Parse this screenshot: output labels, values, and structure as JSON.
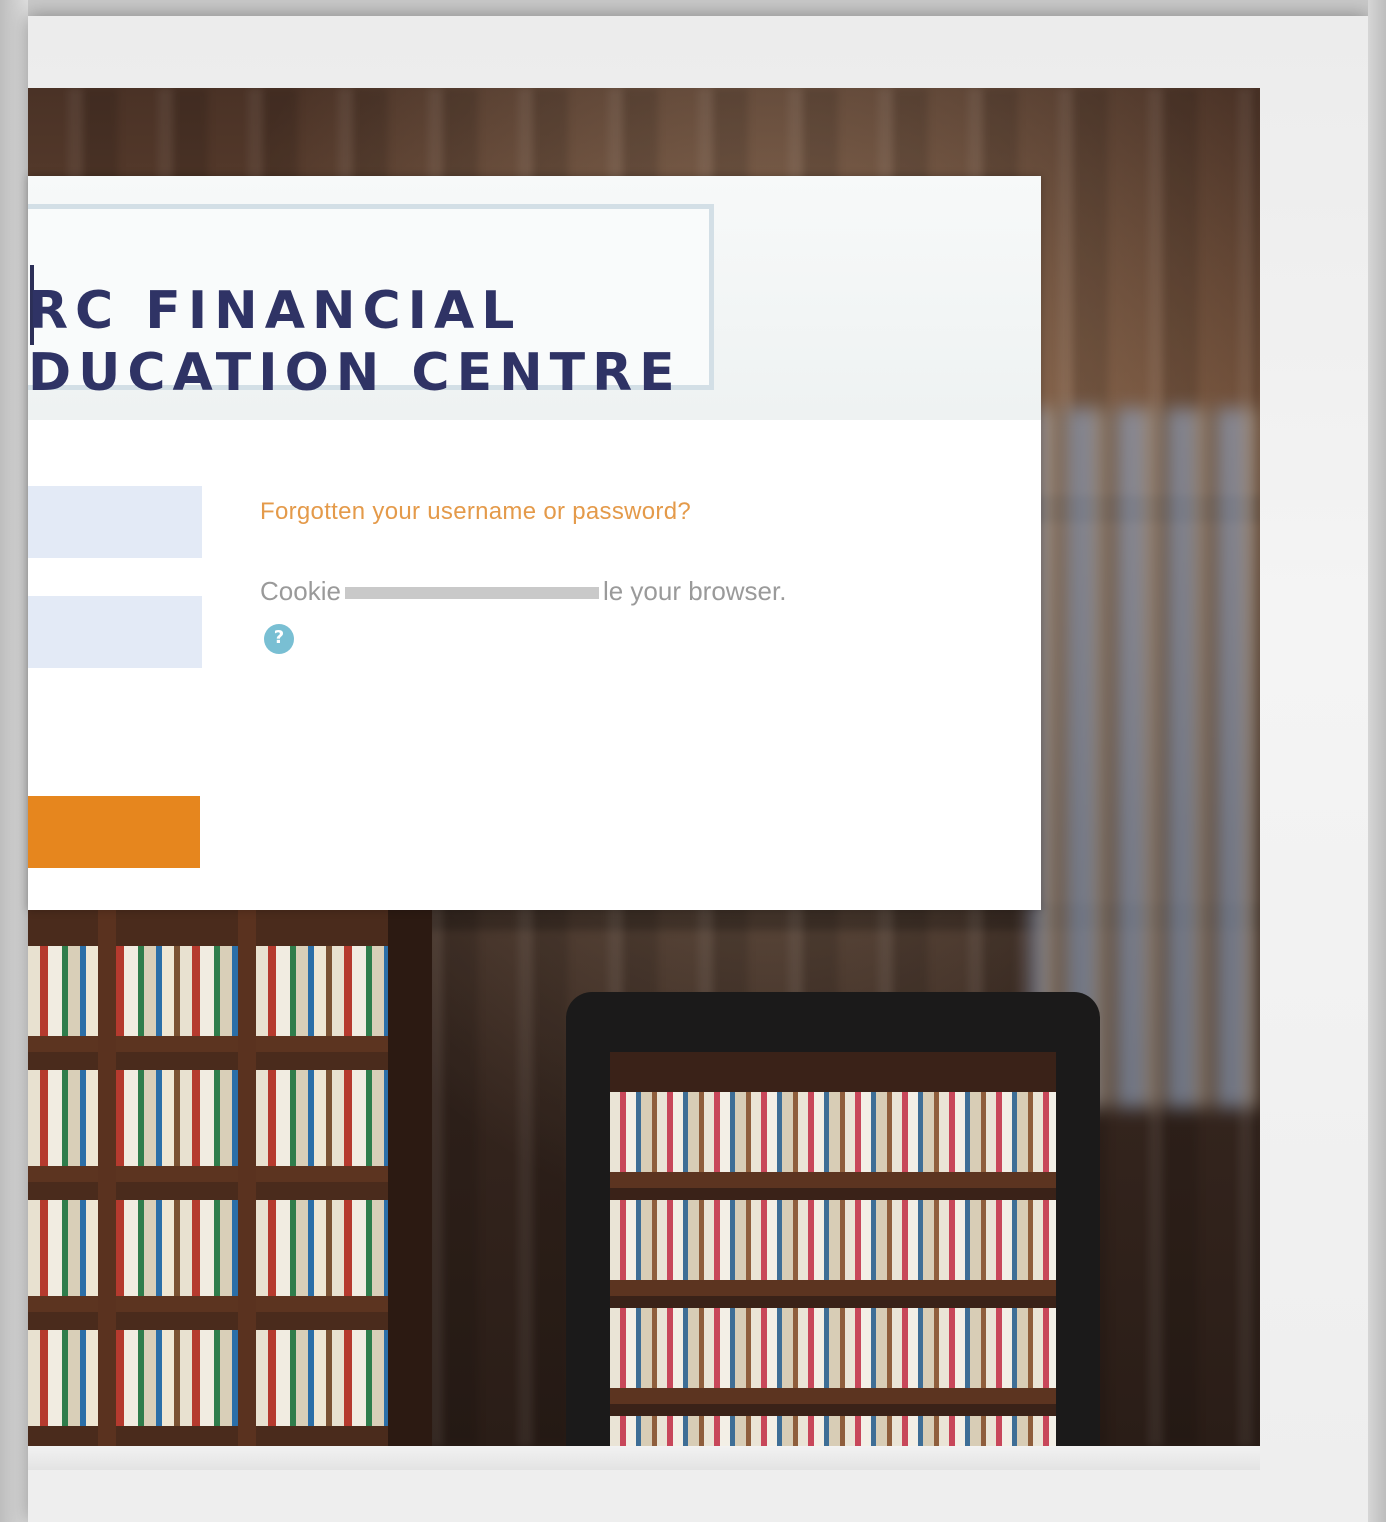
{
  "logo": {
    "line1": "RC FINANCIAL",
    "line2": "DUCATION CENTRE"
  },
  "login": {
    "username_placeholder": "",
    "password_placeholder": "",
    "login_button_label": "",
    "forgot_link": "Forgotten your username or password?",
    "cookies_prefix": "Cookie",
    "cookies_suffix": "le your browser.",
    "help_icon_glyph": "?"
  },
  "colors": {
    "accent_orange": "#e6861e",
    "logo_navy": "#2f3365",
    "input_bg": "#e3eaf6",
    "help_blue": "#79bfd3"
  }
}
